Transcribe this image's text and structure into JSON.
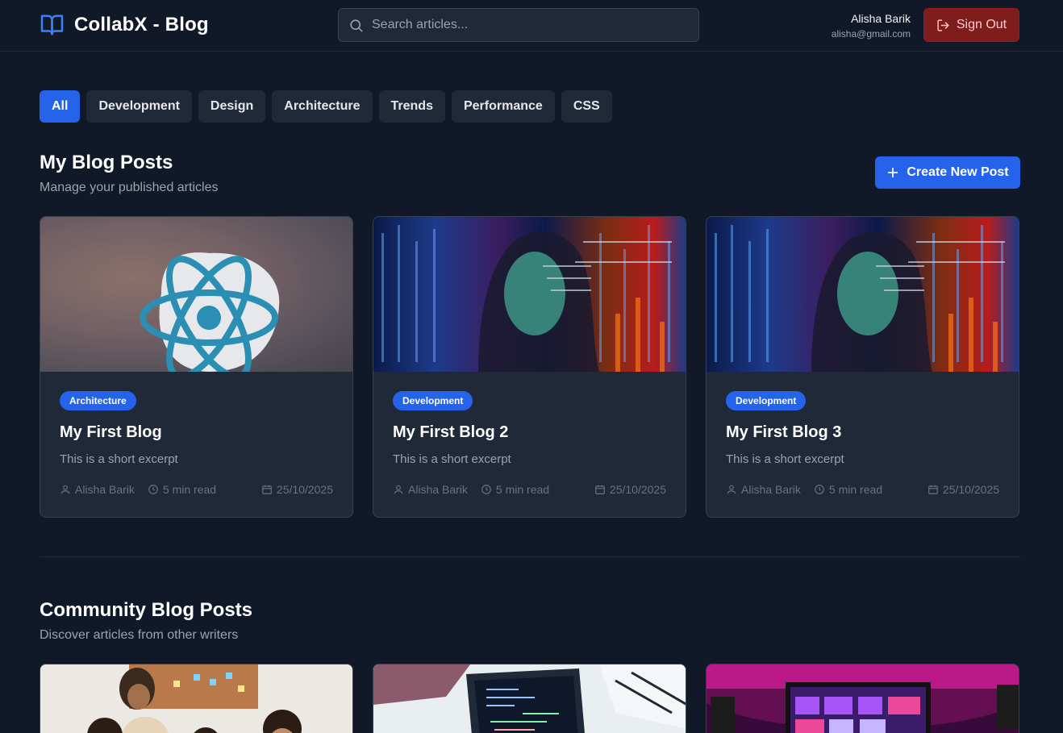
{
  "header": {
    "brand": "CollabX - Blog",
    "search_placeholder": "Search articles...",
    "user_name": "Alisha Barik",
    "user_email": "alisha@gmail.com",
    "signout_label": "Sign Out"
  },
  "filters": [
    "All",
    "Development",
    "Design",
    "Architecture",
    "Trends",
    "Performance",
    "CSS"
  ],
  "my_posts": {
    "title": "My Blog Posts",
    "subtitle": "Manage your published articles",
    "create_label": "Create New Post",
    "cards": [
      {
        "category": "Architecture",
        "title": "My First Blog",
        "excerpt": "This is a short excerpt",
        "author": "Alisha Barik",
        "read_time": "5 min read",
        "date": "25/10/2025"
      },
      {
        "category": "Development",
        "title": "My First Blog 2",
        "excerpt": "This is a short excerpt",
        "author": "Alisha Barik",
        "read_time": "5 min read",
        "date": "25/10/2025"
      },
      {
        "category": "Development",
        "title": "My First Blog 3",
        "excerpt": "This is a short excerpt",
        "author": "Alisha Barik",
        "read_time": "5 min read",
        "date": "25/10/2025"
      }
    ]
  },
  "community": {
    "title": "Community Blog Posts",
    "subtitle": "Discover articles from other writers"
  },
  "colors": {
    "background": "#111827",
    "surface": "#1f2937",
    "accent": "#2563eb",
    "danger": "#7f1d1d"
  }
}
